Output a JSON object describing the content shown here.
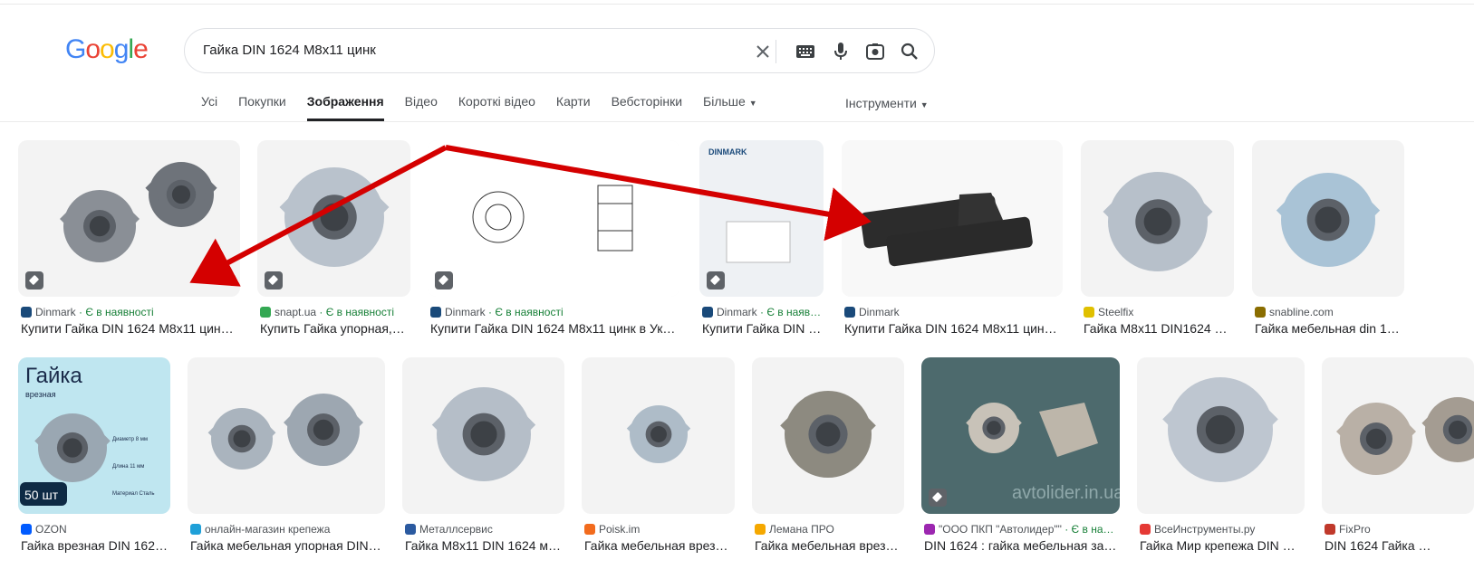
{
  "search": {
    "query": "Гайка DIN 1624 M8x11 цинк"
  },
  "logo": {
    "text": "Google",
    "colors": [
      "#4285F4",
      "#EA4335",
      "#FBBC05",
      "#4285F4",
      "#34A853",
      "#EA4335"
    ]
  },
  "tabs": [
    {
      "label": "Усі"
    },
    {
      "label": "Покупки"
    },
    {
      "label": "Зображення"
    },
    {
      "label": "Відео"
    },
    {
      "label": "Короткі відео"
    },
    {
      "label": "Карти"
    },
    {
      "label": "Вебсторінки"
    },
    {
      "label": "Більше"
    }
  ],
  "active_tab": "Зображення",
  "tools_label": "Інструменти",
  "results": [
    {
      "source": "Dinmark",
      "stock": " · Є в наявності",
      "title": "Купити Гайка DIN 1624 M8x11 цин…",
      "fav_color": "#1a4a7a",
      "tag": true
    },
    {
      "source": "snapt.ua",
      "stock": " · Є в наявності",
      "title": "Купить Гайка упорная,…",
      "fav_color": "#34a853",
      "tag": true
    },
    {
      "source": "Dinmark",
      "stock": " · Є в наявності",
      "title": "Купити Гайка DIN 1624 M8x11 цинк в Ук…",
      "fav_color": "#1a4a7a",
      "tag": true
    },
    {
      "source": "Dinmark",
      "stock": " · Є в наяв…",
      "title": "Купити Гайка DIN …",
      "fav_color": "#1a4a7a",
      "tag": true
    },
    {
      "source": "Dinmark",
      "stock": "",
      "title": "Купити Гайка DIN 1624 M8x11 цин…",
      "fav_color": "#1a4a7a",
      "tag": false
    },
    {
      "source": "Steelfix",
      "stock": "",
      "title": "Гайка M8x11 DIN1624 …",
      "fav_color": "#e0c000",
      "tag": false
    },
    {
      "source": "snabline.com",
      "stock": "",
      "title": "Гайка мебельная din 1…",
      "fav_color": "#8a6d00",
      "tag": false
    },
    {
      "source": "OZON",
      "stock": "",
      "title": "Гайка врезная DIN 162…",
      "fav_color": "#005bff",
      "tag": false
    },
    {
      "source": "онлайн-магазин крепежа",
      "stock": "",
      "title": "Гайка мебельная упорная DIN…",
      "fav_color": "#1fa0d8",
      "tag": false
    },
    {
      "source": "Металлсервис",
      "stock": "",
      "title": "Гайка M8x11 DIN 1624 м…",
      "fav_color": "#2b5aa0",
      "tag": false
    },
    {
      "source": "Poisk.im",
      "stock": "",
      "title": "Гайка мебельная врез…",
      "fav_color": "#f26b1d",
      "tag": false
    },
    {
      "source": "Лемана ПРО",
      "stock": "",
      "title": "Гайка мебельная врез…",
      "fav_color": "#f5a800",
      "tag": false
    },
    {
      "source": "\"ООО ПКП \"Автолидер\"\"",
      "stock": " · Є в на…",
      "title": "DIN 1624 : гайка мебельная за…",
      "fav_color": "#9c27b0",
      "tag": true
    },
    {
      "source": "ВсеИнструменты.ру",
      "stock": "",
      "title": "Гайка Мир крепежа DIN …",
      "fav_color": "#e53935",
      "tag": false
    },
    {
      "source": "FixPro",
      "stock": "",
      "title": "DIN 1624 Гайка …",
      "fav_color": "#c0392b",
      "tag": false
    }
  ],
  "image_text": {
    "ozon_heading": "Гайка",
    "ozon_sub": "врезная",
    "ozon_count": "50 шт",
    "ozon_spec1": "Диаметр 8 мм",
    "ozon_spec2": "Длина 11 мм",
    "ozon_spec3": "Материал Сталь",
    "watermark": "avtolider.in.ua",
    "dinmark_logo": "DINMARK"
  },
  "arrow_color": "#d40000"
}
